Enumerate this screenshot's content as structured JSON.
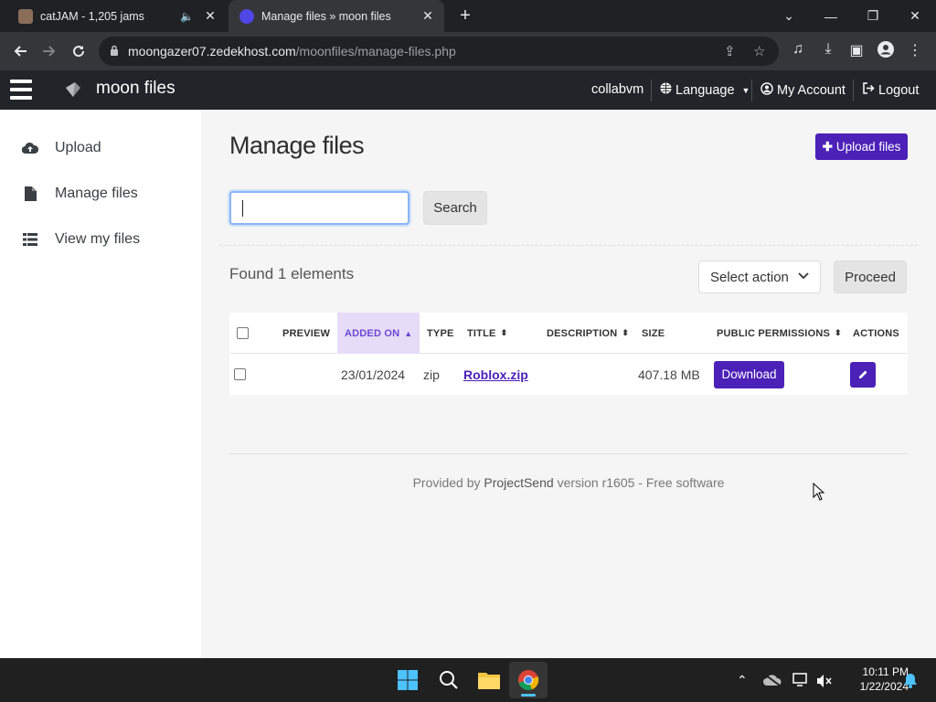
{
  "browser": {
    "tabs": [
      {
        "title": "catJAM - 1,205 jams",
        "active": false,
        "audio": true
      },
      {
        "title": "Manage files » moon files",
        "active": true,
        "audio": false
      }
    ],
    "url_host": "moongazer07.zedekhost.com",
    "url_path": "/moonfiles/manage-files.php",
    "window_controls": {
      "minimize": "—",
      "restore": "❐",
      "close": "✕",
      "tablist": "⌄"
    }
  },
  "app": {
    "brand": "moon files",
    "nav": {
      "user": "collabvm",
      "language": "Language",
      "account": "My Account",
      "logout": "Logout"
    },
    "sidebar": {
      "items": [
        {
          "label": "Upload",
          "icon": "cloud-upload-icon"
        },
        {
          "label": "Manage files",
          "icon": "file-icon"
        },
        {
          "label": "View my files",
          "icon": "list-icon"
        }
      ]
    }
  },
  "main": {
    "title": "Manage files",
    "upload_button": "Upload files",
    "search": {
      "value": "",
      "button": "Search"
    },
    "results_text": "Found 1 elements",
    "bulk": {
      "select_label": "Select action",
      "proceed": "Proceed"
    },
    "table": {
      "headers": {
        "preview": "PREVIEW",
        "added_on": "ADDED ON",
        "type": "TYPE",
        "title": "TITLE",
        "description": "DESCRIPTION",
        "size": "SIZE",
        "public_permissions": "PUBLIC PERMISSIONS",
        "actions": "ACTIONS"
      },
      "rows": [
        {
          "added_on": "23/01/2024",
          "type": "zip",
          "title": "Roblox.zip",
          "description": "",
          "size": "407.18 MB",
          "permission_button": "Download"
        }
      ]
    },
    "footer": {
      "prefix": "Provided by",
      "link": "ProjectSend",
      "suffix": "version r1605 - Free software"
    }
  },
  "taskbar": {
    "time": "10:11 PM",
    "date": "1/22/2024"
  },
  "colors": {
    "accent": "#4b21b8",
    "navbar": "#212529",
    "sort_active_bg": "#e6dcf7"
  }
}
